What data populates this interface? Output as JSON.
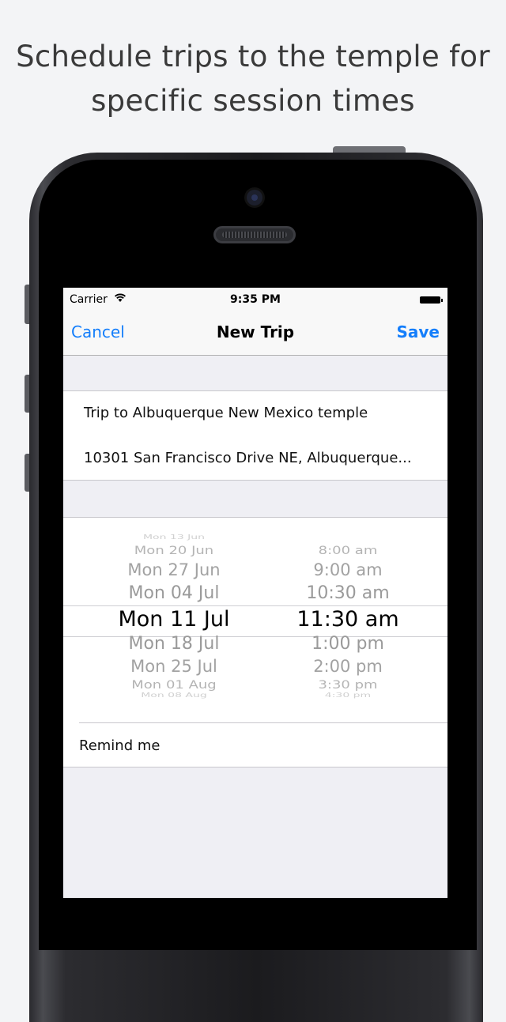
{
  "headline": {
    "line1": "Schedule trips to the temple for",
    "line2": "specific session times"
  },
  "status_bar": {
    "carrier": "Carrier",
    "wifi_icon": "wifi-icon",
    "time": "9:35 PM",
    "battery_icon": "battery-icon"
  },
  "nav": {
    "cancel_label": "Cancel",
    "title": "New Trip",
    "save_label": "Save",
    "accent_color": "#147efb"
  },
  "trip": {
    "title": "Trip to Albuquerque New Mexico temple",
    "address": "10301 San Francisco Drive NE, Albuquerque..."
  },
  "picker": {
    "dates": [
      "Mon 13 Jun",
      "Mon 20 Jun",
      "Mon 27 Jun",
      "Mon 04 Jul",
      "Mon 11 Jul",
      "Mon 18 Jul",
      "Mon 25 Jul",
      "Mon 01 Aug",
      "Mon 08 Aug"
    ],
    "selected_date": "Mon 11 Jul",
    "times": [
      "8:00 am",
      "9:00 am",
      "10:30 am",
      "11:30 am",
      "1:00 pm",
      "2:00 pm",
      "3:30 pm",
      "4:30 pm"
    ],
    "selected_time": "11:30 am"
  },
  "remind": {
    "label": "Remind me"
  }
}
